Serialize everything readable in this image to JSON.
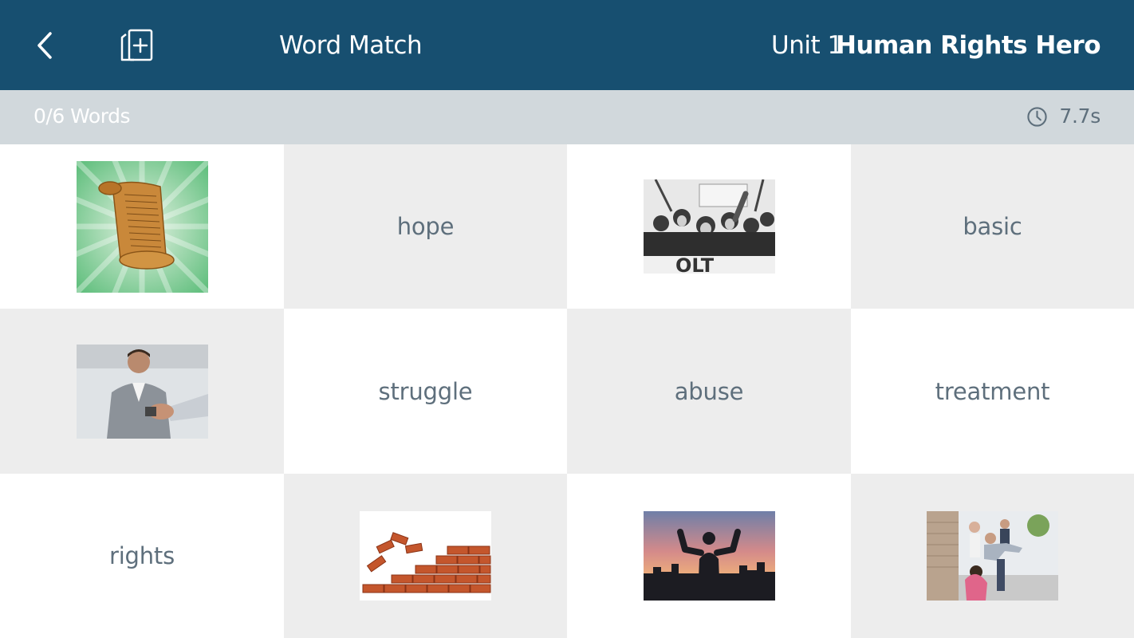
{
  "header": {
    "title": "Word Match",
    "unit": "Unit 1",
    "lesson": "Human Rights Hero"
  },
  "status": {
    "progress": "0/6 Words",
    "time": "7.7s"
  },
  "colors": {
    "header_bg": "#174f70",
    "subbar_bg": "#d1d8dc",
    "tile_white": "#ffffff",
    "tile_grey": "#ededed",
    "word_text": "#5e6f7c"
  },
  "tiles": [
    {
      "kind": "image",
      "icon": "scroll-document-image"
    },
    {
      "kind": "word",
      "text": "hope"
    },
    {
      "kind": "image",
      "icon": "protest-crowd-image"
    },
    {
      "kind": "word",
      "text": "basic"
    },
    {
      "kind": "image",
      "icon": "handshake-image"
    },
    {
      "kind": "word",
      "text": "struggle"
    },
    {
      "kind": "word",
      "text": "abuse"
    },
    {
      "kind": "word",
      "text": "treatment"
    },
    {
      "kind": "word",
      "text": "rights"
    },
    {
      "kind": "image",
      "icon": "bricks-image"
    },
    {
      "kind": "image",
      "icon": "silhouette-sunset-image"
    },
    {
      "kind": "image",
      "icon": "bullying-children-image"
    }
  ]
}
